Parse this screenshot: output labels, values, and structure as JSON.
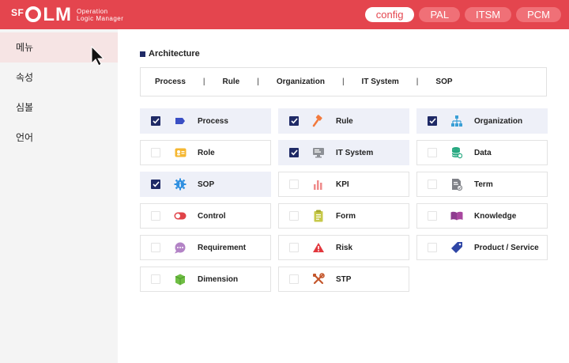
{
  "header": {
    "logo_sf": "SF",
    "logo_olm": "LM",
    "logo_sub1": "Operation",
    "logo_sub2": "Logic Manager",
    "tabs": [
      {
        "label": "config",
        "active": true
      },
      {
        "label": "PAL"
      },
      {
        "label": "ITSM"
      },
      {
        "label": "PCM"
      }
    ]
  },
  "sidebar": {
    "items": [
      {
        "label": "메뉴",
        "active": true
      },
      {
        "label": "속성"
      },
      {
        "label": "심볼"
      },
      {
        "label": "언어"
      }
    ]
  },
  "main": {
    "section_title": "Architecture",
    "breadcrumbs": [
      "Process",
      "Rule",
      "Organization",
      "IT System",
      "SOP"
    ],
    "separator": "|",
    "cards": [
      {
        "label": "Process",
        "checked": true,
        "icon": "process-tag-icon"
      },
      {
        "label": "Rule",
        "checked": true,
        "icon": "gavel-icon"
      },
      {
        "label": "Organization",
        "checked": true,
        "icon": "org-chart-icon"
      },
      {
        "label": "Role",
        "checked": false,
        "icon": "id-card-icon"
      },
      {
        "label": "IT System",
        "checked": true,
        "icon": "monitor-icon"
      },
      {
        "label": "Data",
        "checked": false,
        "icon": "database-icon"
      },
      {
        "label": "SOP",
        "checked": true,
        "icon": "gear-badge-icon"
      },
      {
        "label": "KPI",
        "checked": false,
        "icon": "bar-chart-icon"
      },
      {
        "label": "Term",
        "checked": false,
        "icon": "document-icon"
      },
      {
        "label": "Control",
        "checked": false,
        "icon": "toggle-icon"
      },
      {
        "label": "Form",
        "checked": false,
        "icon": "clipboard-icon"
      },
      {
        "label": "Knowledge",
        "checked": false,
        "icon": "book-icon"
      },
      {
        "label": "Requirement",
        "checked": false,
        "icon": "chat-bubble-icon"
      },
      {
        "label": "Risk",
        "checked": false,
        "icon": "warning-icon"
      },
      {
        "label": "Product / Service",
        "checked": false,
        "icon": "price-tag-icon"
      },
      {
        "label": "Dimension",
        "checked": false,
        "icon": "cube-icon"
      },
      {
        "label": "STP",
        "checked": false,
        "icon": "tools-icon"
      }
    ]
  },
  "colors": {
    "brand_red": "#e4454e",
    "check_navy": "#1f2a66",
    "checked_card_bg": "#eef0f8"
  }
}
